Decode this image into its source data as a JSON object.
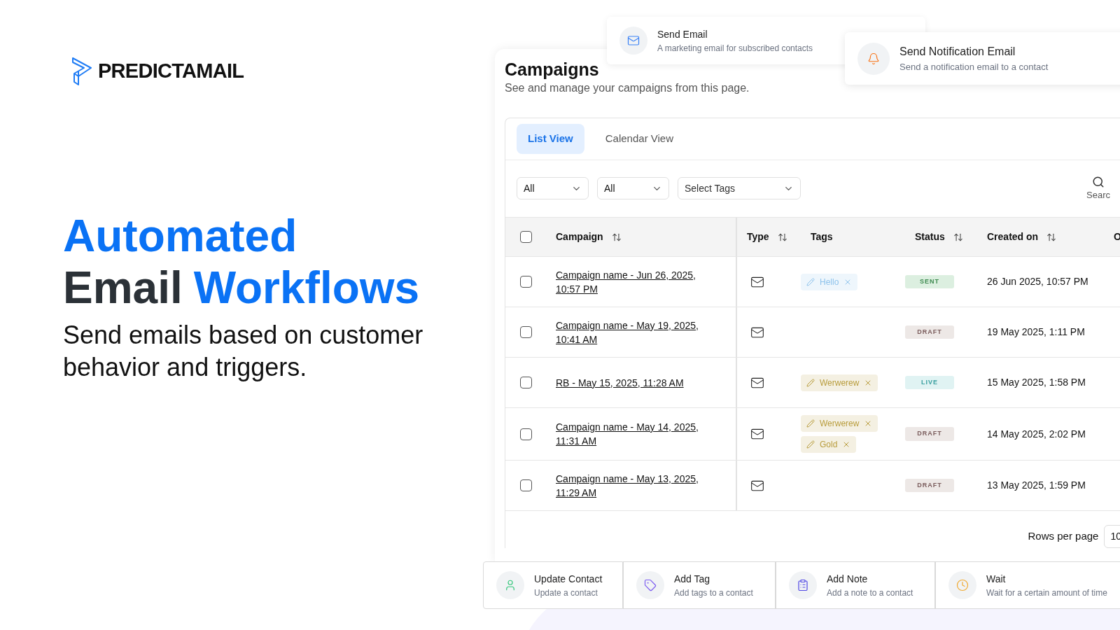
{
  "brand": {
    "name": "PREDICTAMAIL"
  },
  "hero": {
    "lines": [
      [
        {
          "text": "Automated",
          "highlight": true
        }
      ],
      [
        {
          "text": "Email",
          "highlight": false
        },
        {
          "text": "Workflows",
          "highlight": true
        }
      ]
    ],
    "subtitle": "Send emails based on customer behavior and triggers."
  },
  "triggers": [
    {
      "title": "Send Email",
      "description": "A marketing email for subscribed contacts",
      "kind": "mail"
    },
    {
      "title": "Send Notification Email",
      "description": "Send a notification email to a contact",
      "kind": "bell"
    }
  ],
  "campaigns": {
    "title": "Campaigns",
    "subtitle": "See and manage your campaigns from this page.",
    "tabs": [
      {
        "label": "List View",
        "selected": true
      },
      {
        "label": "Calendar View",
        "selected": false
      }
    ],
    "filters": [
      {
        "value": "All"
      },
      {
        "value": "All"
      },
      {
        "placeholder": "Select Tags"
      }
    ],
    "search_label": "Searc",
    "table": {
      "select_all": {
        "checked": false
      },
      "columns": [
        {
          "label": "Campaign",
          "sortable": true
        },
        {
          "label": "Type",
          "sortable": true
        },
        {
          "label": "Tags",
          "sortable": false
        },
        {
          "label": "Status",
          "sortable": true
        },
        {
          "label": "Created on",
          "sortable": true
        },
        {
          "label": "O"
        }
      ],
      "rows": [
        {
          "checked": false,
          "campaign": "Campaign name - Jun 26, 2025, 10:57 PM",
          "type": {
            "kind": "email"
          },
          "tags": [
            {
              "label": "Hello",
              "color": "#8ec3ec"
            }
          ],
          "status": {
            "label": "SENT",
            "kind": "sent"
          },
          "created": "26 Jun 2025, 10:57 PM"
        },
        {
          "checked": false,
          "campaign": "Campaign name - May 19, 2025, 10:41 AM",
          "type": {
            "kind": "email"
          },
          "tags": [],
          "status": {
            "label": "DRAFT",
            "kind": "draft"
          },
          "created": "19 May 2025, 1:11 PM"
        },
        {
          "checked": false,
          "campaign": "RB - May 15, 2025, 11:28 AM",
          "type": {
            "kind": "email"
          },
          "tags": [
            {
              "label": "Werwerew",
              "color": "#b89c3c"
            }
          ],
          "status": {
            "label": "LIVE",
            "kind": "live"
          },
          "created": "15 May 2025, 1:58 PM"
        },
        {
          "checked": false,
          "campaign": "Campaign name - May 14, 2025, 11:31 AM",
          "type": {
            "kind": "email"
          },
          "tags": [
            {
              "label": "Werwerew",
              "color": "#b89c3c"
            },
            {
              "label": "Gold",
              "color": "#b89c3c"
            }
          ],
          "status": {
            "label": "DRAFT",
            "kind": "draft"
          },
          "created": "14 May 2025, 2:02 PM"
        },
        {
          "checked": false,
          "campaign": "Campaign name - May 13, 2025, 11:29 AM",
          "type": {
            "kind": "email"
          },
          "tags": [],
          "status": {
            "label": "DRAFT",
            "kind": "draft"
          },
          "created": "13 May 2025, 1:59 PM"
        }
      ]
    },
    "footer": {
      "rows_per_page_label": "Rows per page",
      "rows_per_page_value": "10"
    }
  },
  "actions": [
    {
      "title": "Update Contact",
      "description": "Update a contact",
      "kind": "user"
    },
    {
      "title": "Add Tag",
      "description": "Add tags to a contact",
      "kind": "tag"
    },
    {
      "title": "Add Note",
      "description": "Add a note to a contact",
      "kind": "note"
    },
    {
      "title": "Wait",
      "description": "Wait for a certain amount of time",
      "kind": "clock"
    }
  ]
}
